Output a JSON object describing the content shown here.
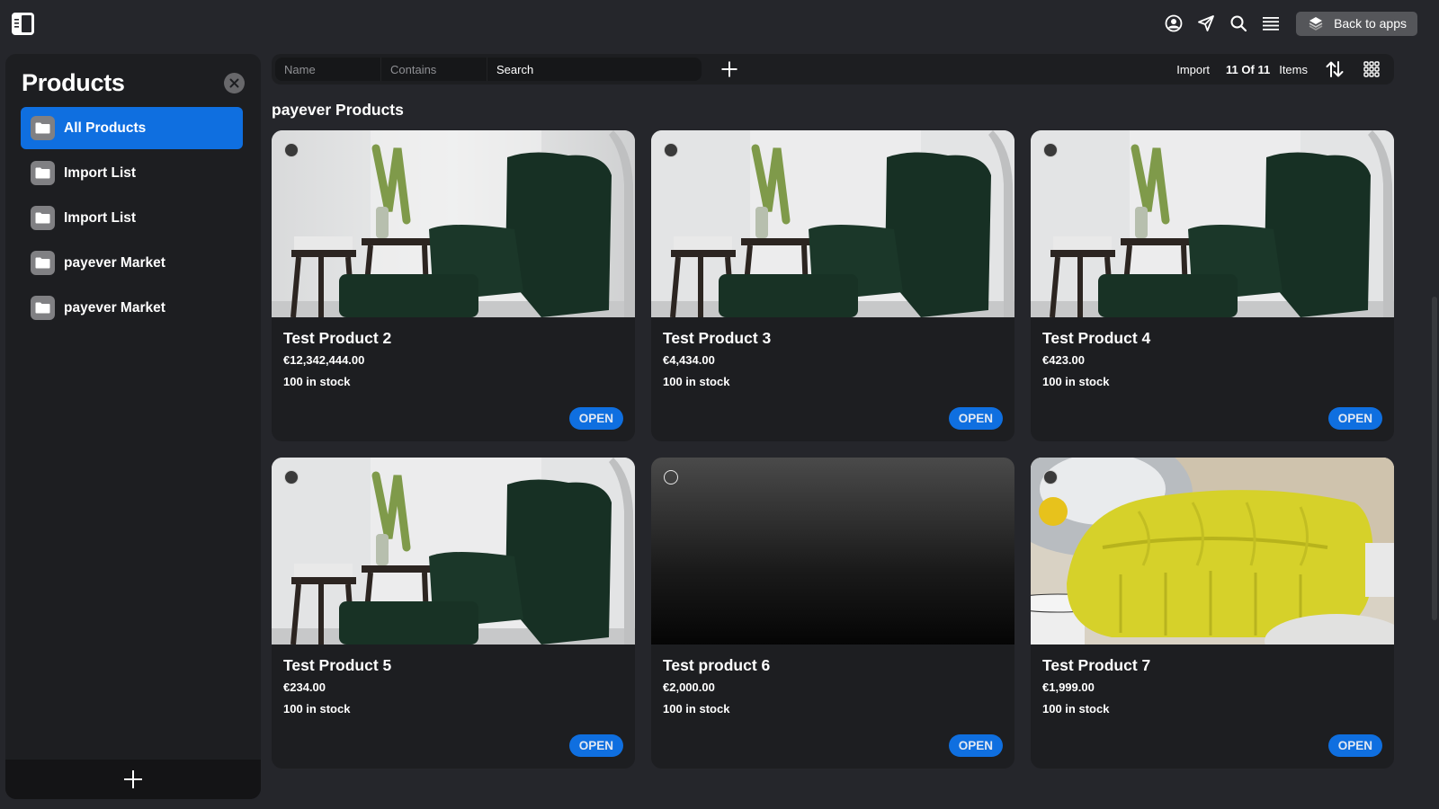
{
  "topbar": {
    "back_to_apps_label": "Back to apps",
    "icons": [
      "sidebar-toggle-icon",
      "profile-icon",
      "send-icon",
      "search-icon",
      "menu-icon",
      "layers-icon"
    ]
  },
  "sidebar": {
    "title": "Products",
    "items": [
      {
        "label": "All Products",
        "active": true
      },
      {
        "label": "Import List",
        "active": false
      },
      {
        "label": "Import List",
        "active": false
      },
      {
        "label": "payever Market",
        "active": false
      },
      {
        "label": "payever Market",
        "active": false
      }
    ]
  },
  "toolbar": {
    "filter_field": "Name",
    "filter_condition": "Contains",
    "search_placeholder": "Search",
    "import_label": "Import",
    "count_label": "11 Of 11",
    "items_label": "Items"
  },
  "section_title": "payever Products",
  "products": [
    {
      "title": "Test Product 2",
      "price": "€12,342,444.00",
      "stock": "100 in stock",
      "image": "green-armchair",
      "open_label": "OPEN"
    },
    {
      "title": "Test Product 3",
      "price": "€4,434.00",
      "stock": "100 in stock",
      "image": "green-armchair",
      "open_label": "OPEN"
    },
    {
      "title": "Test Product 4",
      "price": "€423.00",
      "stock": "100 in stock",
      "image": "green-armchair",
      "open_label": "OPEN"
    },
    {
      "title": "Test Product 5",
      "price": "€234.00",
      "stock": "100 in stock",
      "image": "green-armchair",
      "open_label": "OPEN"
    },
    {
      "title": "Test product 6",
      "price": "€2,000.00",
      "stock": "100 in stock",
      "image": "none",
      "open_label": "OPEN"
    },
    {
      "title": "Test Product 7",
      "price": "€1,999.00",
      "stock": "100 in stock",
      "image": "yellow-sofa",
      "open_label": "OPEN"
    }
  ],
  "colors": {
    "accent": "#0f6fe0",
    "background": "#25262b",
    "panel": "#1d1e21"
  }
}
